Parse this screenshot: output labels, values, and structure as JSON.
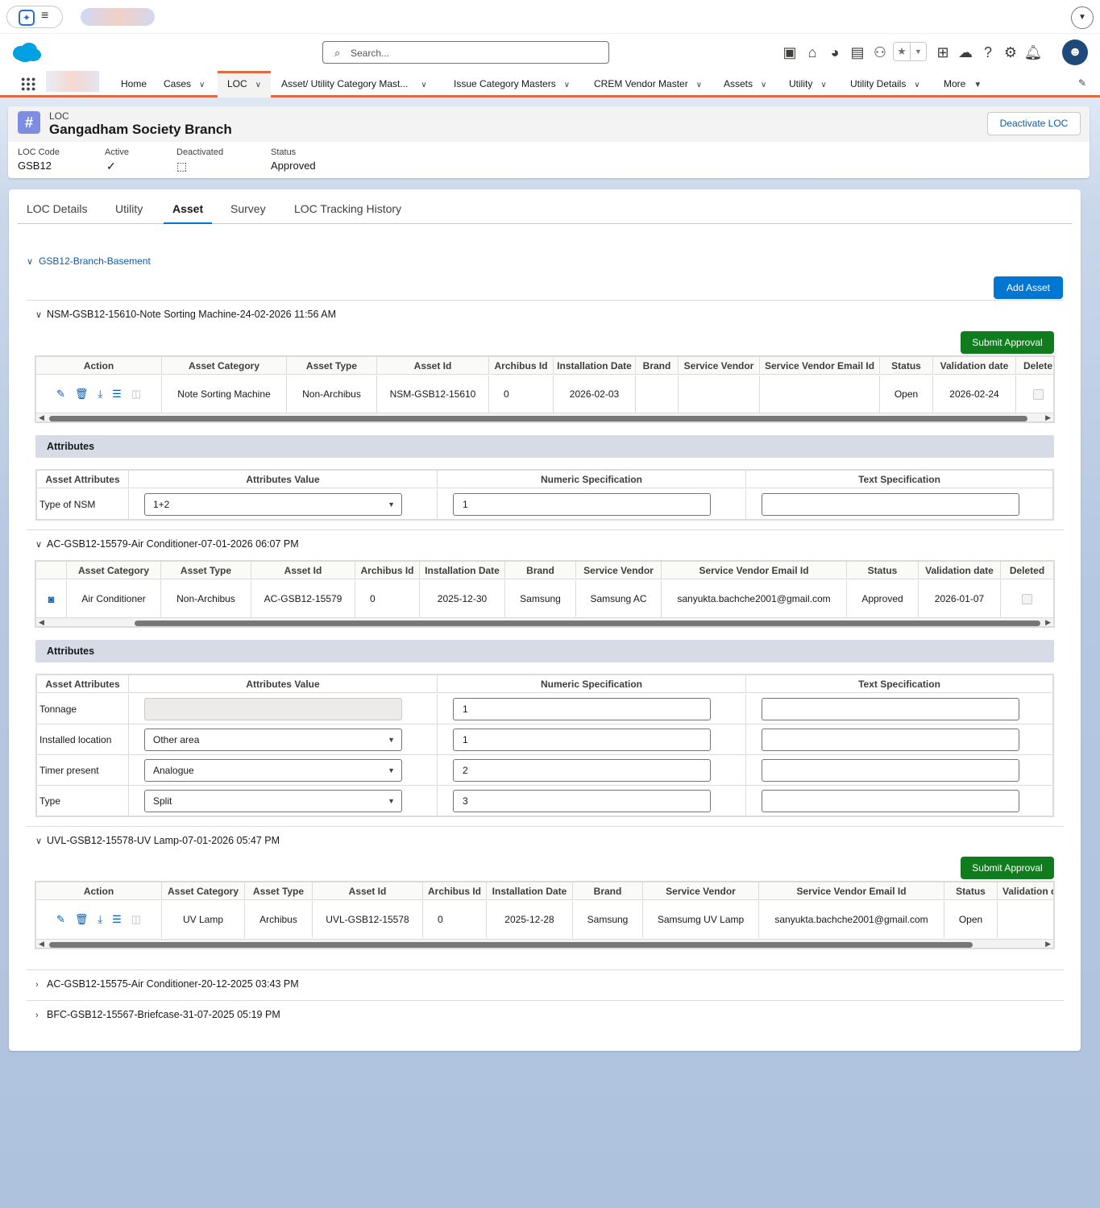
{
  "browser": {
    "menu_icon": "hamburger-icon"
  },
  "header": {
    "search_placeholder": "Search..."
  },
  "nav": {
    "items": [
      {
        "label": "Home",
        "dropdown": false
      },
      {
        "label": "Cases",
        "dropdown": true
      },
      {
        "label": "LOC",
        "dropdown": true,
        "active": true
      },
      {
        "label": "Asset/ Utility Category Mast...",
        "dropdown": true
      },
      {
        "label": "Issue Category Masters",
        "dropdown": true
      },
      {
        "label": "CREM Vendor Master",
        "dropdown": true
      },
      {
        "label": "Assets",
        "dropdown": true
      },
      {
        "label": "Utility",
        "dropdown": true
      },
      {
        "label": "Utility Details",
        "dropdown": true
      },
      {
        "label": "More",
        "dropdown": true
      }
    ]
  },
  "record": {
    "type": "LOC",
    "title": "Gangadham Society Branch",
    "deactivate_label": "Deactivate LOC",
    "fields": [
      {
        "label": "LOC Code",
        "value": "GSB12"
      },
      {
        "label": "Active",
        "value": "✓"
      },
      {
        "label": "Deactivated",
        "value": "⬚"
      },
      {
        "label": "Status",
        "value": "Approved"
      }
    ]
  },
  "tabs": [
    "LOC Details",
    "Utility",
    "Asset",
    "Survey",
    "LOC Tracking History"
  ],
  "active_tab": "Asset",
  "location_section": "GSB12-Branch-Basement",
  "add_asset_label": "Add Asset",
  "submit_label": "Submit Approval",
  "attributes_label": "Attributes",
  "attr_headers": [
    "Asset Attributes",
    "Attributes Value",
    "Numeric Specification",
    "Text Specification"
  ],
  "assets": [
    {
      "title": "NSM-GSB12-15610-Note Sorting Machine-24-02-2026 11:56 AM",
      "headers": [
        "Action",
        "Asset Category",
        "Asset Type",
        "Asset Id",
        "Archibus Id",
        "Installation Date",
        "Brand",
        "Service Vendor",
        "Service Vendor Email Id",
        "Status",
        "Validation date",
        "Delete"
      ],
      "row": [
        "",
        "Note Sorting Machine",
        "Non-Archibus",
        "NSM-GSB12-15610",
        "0",
        "2026-02-03",
        "",
        "",
        "",
        "Open",
        "2026-02-24",
        ""
      ],
      "attributes": [
        {
          "name": "Type of NSM",
          "value": "1+2",
          "numeric": "1",
          "text": ""
        }
      ]
    },
    {
      "title": "AC-GSB12-15579-Air Conditioner-07-01-2026 06:07 PM",
      "headers": [
        "",
        "Asset Category",
        "Asset Type",
        "Asset Id",
        "Archibus Id",
        "Installation Date",
        "Brand",
        "Service Vendor",
        "Service Vendor Email Id",
        "Status",
        "Validation date",
        "Deleted"
      ],
      "row": [
        "",
        "Air Conditioner",
        "Non-Archibus",
        "AC-GSB12-15579",
        "0",
        "2025-12-30",
        "Samsung",
        "Samsung AC",
        "sanyukta.bachche2001@gmail.com",
        "Approved",
        "2026-01-07",
        ""
      ],
      "attributes": [
        {
          "name": "Tonnage",
          "value": "",
          "numeric": "1",
          "text": ""
        },
        {
          "name": "Installed location",
          "value": "Other area",
          "numeric": "1",
          "text": ""
        },
        {
          "name": "Timer present",
          "value": "Analogue",
          "numeric": "2",
          "text": ""
        },
        {
          "name": "Type",
          "value": "Split",
          "numeric": "3",
          "text": ""
        }
      ]
    },
    {
      "title": "UVL-GSB12-15578-UV Lamp-07-01-2026 05:47 PM",
      "headers": [
        "Action",
        "Asset Category",
        "Asset Type",
        "Asset Id",
        "Archibus Id",
        "Installation Date",
        "Brand",
        "Service Vendor",
        "Service Vendor Email Id",
        "Status",
        "Validation d"
      ],
      "row": [
        "",
        "UV Lamp",
        "Archibus",
        "UVL-GSB12-15578",
        "0",
        "2025-12-28",
        "Samsung",
        "Samsumg UV Lamp",
        "sanyukta.bachche2001@gmail.com",
        "Open",
        ""
      ]
    }
  ],
  "collapsed_assets": [
    "AC-GSB12-15575-Air Conditioner-20-12-2025 03:43 PM",
    "BFC-GSB12-15567-Briefcase-31-07-2025 05:19 PM"
  ]
}
